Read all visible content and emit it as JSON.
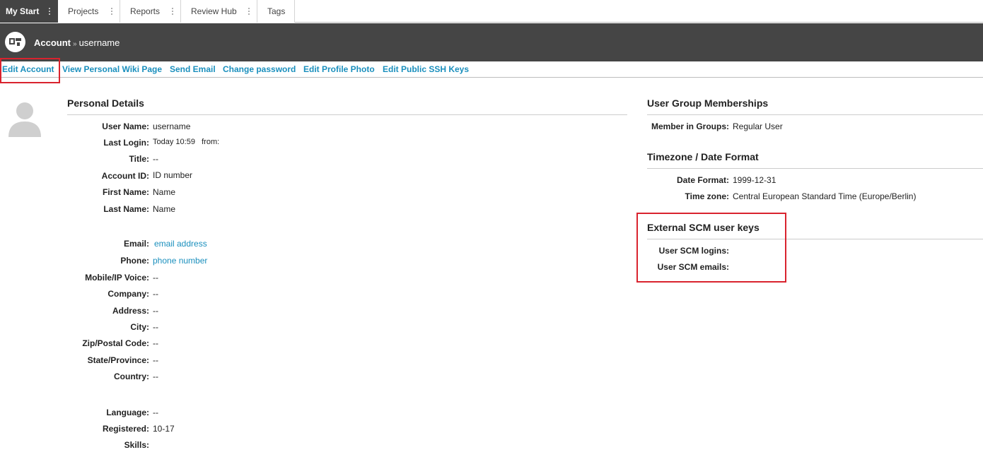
{
  "tabs": [
    {
      "label": "My Start",
      "active": true
    },
    {
      "label": "Projects",
      "active": false
    },
    {
      "label": "Reports",
      "active": false
    },
    {
      "label": "Review Hub",
      "active": false
    },
    {
      "label": "Tags",
      "active": false
    }
  ],
  "header": {
    "breadcrumb_root": "Account",
    "breadcrumb_sep": "»",
    "breadcrumb_current": "username"
  },
  "actions": [
    "Edit Account",
    "View Personal Wiki Page",
    "Send Email",
    "Change password",
    "Edit Profile Photo",
    "Edit Public SSH Keys"
  ],
  "personal": {
    "title": "Personal Details",
    "user_name": {
      "label": "User Name:",
      "value": "username"
    },
    "last_login": {
      "label": "Last Login:",
      "value": "Today 10:59   from:"
    },
    "title_field": {
      "label": "Title:",
      "value": "--"
    },
    "account_id": {
      "label": "Account ID:",
      "value": "ID number"
    },
    "first_name": {
      "label": "First Name:",
      "value": "Name"
    },
    "last_name": {
      "label": "Last Name:",
      "value": "Name"
    },
    "email": {
      "label": "Email:",
      "value": "email address"
    },
    "phone": {
      "label": "Phone:",
      "value": "phone number"
    },
    "mobile": {
      "label": "Mobile/IP Voice:",
      "value": "--"
    },
    "company": {
      "label": "Company:",
      "value": "--"
    },
    "address": {
      "label": "Address:",
      "value": "--"
    },
    "city": {
      "label": "City:",
      "value": "--"
    },
    "zip": {
      "label": "Zip/Postal Code:",
      "value": "--"
    },
    "state": {
      "label": "State/Province:",
      "value": "--"
    },
    "country": {
      "label": "Country:",
      "value": "--"
    },
    "language": {
      "label": "Language:",
      "value": "--"
    },
    "registered": {
      "label": "Registered:",
      "value": "10-17"
    },
    "skills": {
      "label": "Skills:",
      "value": ""
    }
  },
  "groups": {
    "title": "User Group Memberships",
    "member": {
      "label": "Member in Groups:",
      "value": "Regular User"
    }
  },
  "timezone": {
    "title": "Timezone / Date Format",
    "date_format": {
      "label": "Date Format:",
      "value": "1999-12-31"
    },
    "time_zone": {
      "label": "Time zone:",
      "value": "Central European Standard Time (Europe/Berlin)"
    }
  },
  "scm": {
    "title": "External SCM user keys",
    "logins": {
      "label": "User SCM logins:",
      "value": ""
    },
    "emails": {
      "label": "User SCM emails:",
      "value": ""
    }
  },
  "colors": {
    "header_bg": "#454545",
    "link": "#1a8fbd",
    "highlight": "#d9232e",
    "tab_accent": "#f0a830"
  }
}
